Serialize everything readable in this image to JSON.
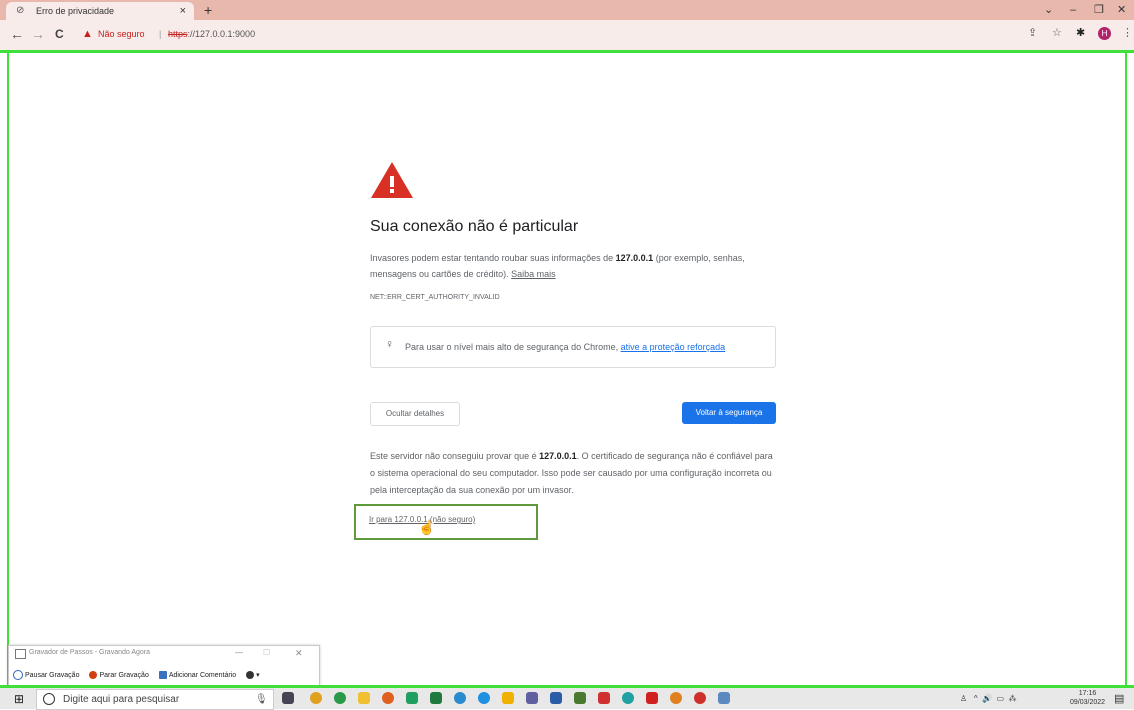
{
  "browser": {
    "tab_title": "Erro de privacidade",
    "tab_close": "×",
    "new_tab": "+",
    "omnibox": {
      "warning_label": "Não seguro",
      "url_scheme": "https",
      "url_rest": "://127.0.0.1:9000"
    },
    "profile_initial": "H",
    "colors": {
      "tab_strip": "#e8b8ac",
      "toolbar": "#f7ece9",
      "highlight": "#3fe03a"
    }
  },
  "page": {
    "heading": "Sua conexão não é particular",
    "desc_pre": "Invasores podem estar tentando roubar suas informações de ",
    "desc_host": "127.0.0.1",
    "desc_post": " (por exemplo, senhas, mensagens ou cartões de crédito). ",
    "learn_more": "Saiba mais",
    "error_code": "NET::ERR_CERT_AUTHORITY_INVALID",
    "tip_text": "Para usar o nível mais alto de segurança do Chrome, ",
    "tip_link": "ative a proteção reforçada",
    "hide_details_btn": "Ocultar detalhes",
    "back_to_safety_btn": "Voltar à segurança",
    "detail_pre": "Este servidor não conseguiu provar que é ",
    "detail_host": "127.0.0.1",
    "detail_post": ". O certificado de segurança não é confiável para o sistema operacional do seu computador. Isso pode ser causado por uma configuração incorreta ou pela interceptação da sua conexão por um invasor.",
    "proceed_link": "Ir para 127.0.0.1 (não seguro)",
    "colors": {
      "error_red": "#d93025",
      "primary_blue": "#1a73e8"
    }
  },
  "recorder": {
    "title": "Gravador de Passos - Gravando Agora",
    "pause": "Pausar Gravação",
    "stop": "Parar Gravação",
    "comment": "Adicionar Comentário"
  },
  "taskbar": {
    "search_placeholder": "Digite aqui para pesquisar",
    "time": "17:16",
    "date": "09/03/2022"
  }
}
